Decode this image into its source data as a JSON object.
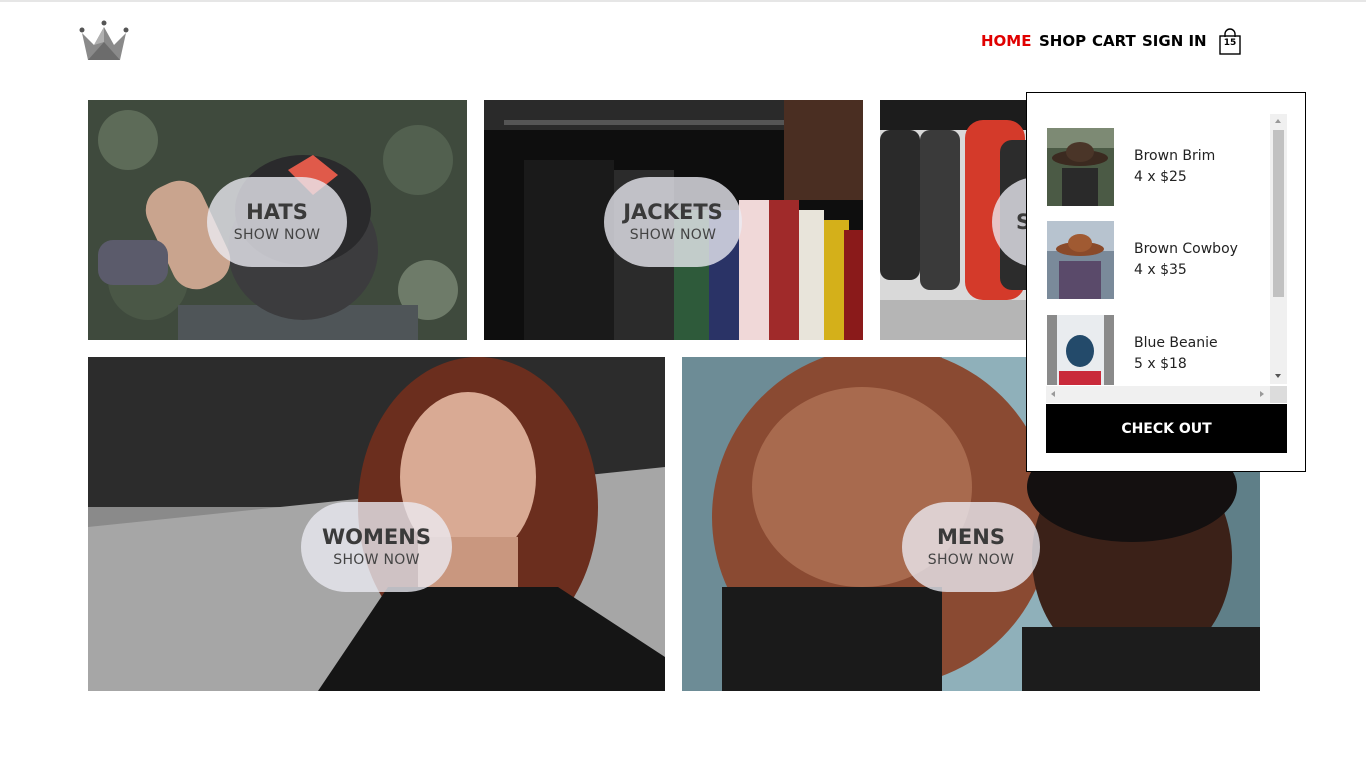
{
  "header": {
    "logo_icon": "crown-icon",
    "nav": {
      "home": "HOME",
      "shop": "SHOP",
      "cart": "CART",
      "sign_in": "SIGN IN"
    },
    "active_color": "#e00000",
    "cart_icon": "shopping-bag-icon",
    "cart_count": "15"
  },
  "directory": {
    "tiles": [
      {
        "title": "HATS",
        "subtitle": "SHOW NOW"
      },
      {
        "title": "JACKETS",
        "subtitle": "SHOW NOW"
      },
      {
        "title": "S",
        "subtitle": ""
      },
      {
        "title": "WOMENS",
        "subtitle": "SHOW NOW"
      },
      {
        "title": "MENS",
        "subtitle": "SHOW NOW"
      }
    ]
  },
  "cart_dropdown": {
    "items": [
      {
        "name": "Brown Brim",
        "qty": "4 x $25"
      },
      {
        "name": "Brown Cowboy",
        "qty": "4 x $35"
      },
      {
        "name": "Blue Beanie",
        "qty": "5 x $18"
      }
    ],
    "checkout_label": "CHECK OUT"
  }
}
